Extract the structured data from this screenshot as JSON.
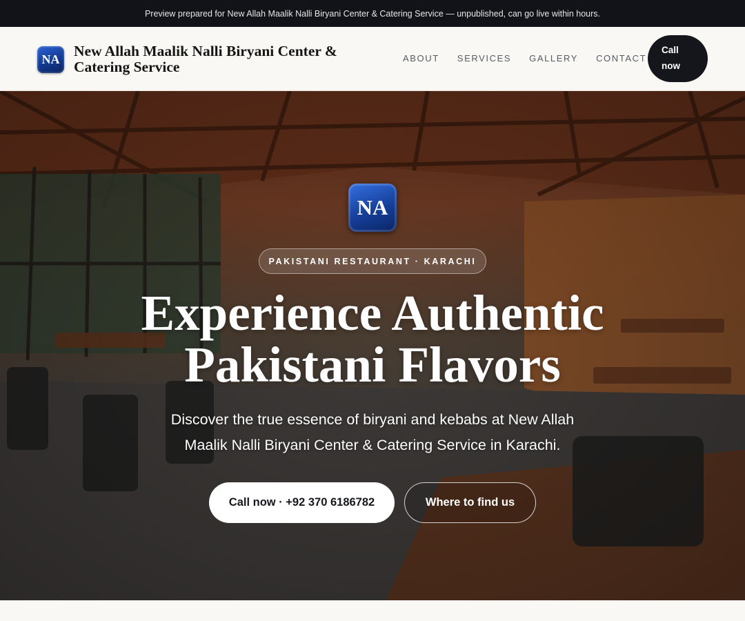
{
  "preview_banner": "Preview prepared for New Allah Maalik Nalli Biryani Center & Catering Service — unpublished, can go live within hours.",
  "header": {
    "logo_text": "NA",
    "brand_name": "New Allah Maalik Nalli Biryani Center & Catering Service",
    "nav": [
      "ABOUT",
      "SERVICES",
      "GALLERY",
      "CONTACT"
    ],
    "call_label_line1": "Call",
    "call_label_line2": "now"
  },
  "hero": {
    "logo_text": "NA",
    "eyebrow": "PAKISTANI RESTAURANT · KARACHI",
    "headline": "Experience Authentic Pakistani Flavors",
    "subheadline": "Discover the true essence of biryani and kebabs at New Allah Maalik Nalli Biryani Center & Catering Service in Karachi.",
    "primary_cta": "Call now · +92 370 6186782",
    "secondary_cta": "Where to find us"
  },
  "colors": {
    "topbar_bg": "#111318",
    "header_bg": "#faf8f4",
    "logo_blue": "#163f9a",
    "dark_button": "#14161c"
  }
}
